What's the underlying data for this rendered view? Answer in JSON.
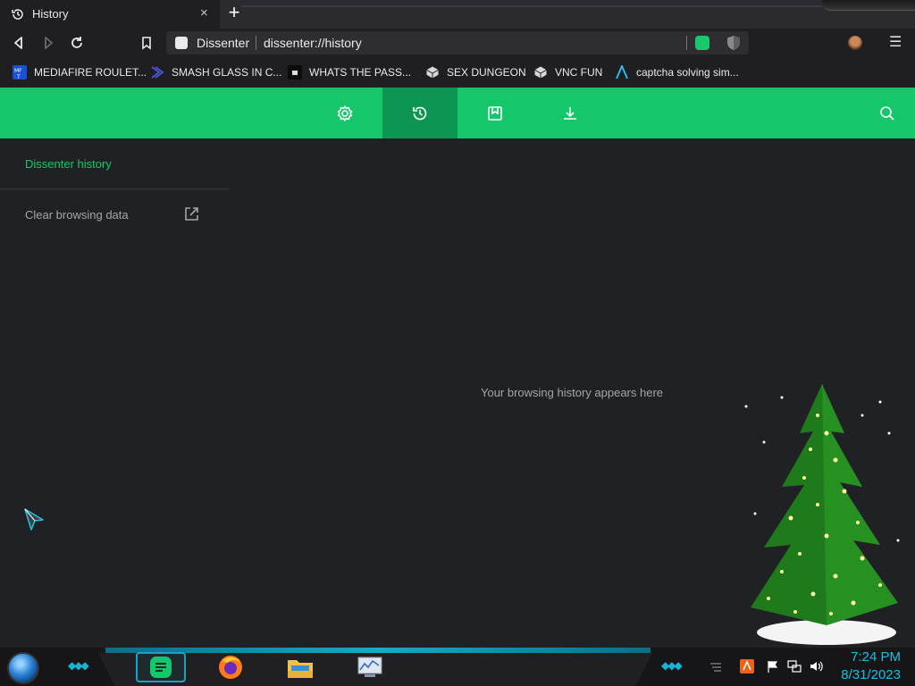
{
  "tab": {
    "title": "History",
    "close": "×",
    "new_tab": "+"
  },
  "omnibox": {
    "site": "Dissenter",
    "url": "dissenter://history"
  },
  "bookmarks": [
    {
      "label": "MEDIAFIRE ROULET...",
      "icon": "mediafire-icon"
    },
    {
      "label": "SMASH GLASS IN C...",
      "icon": "bookmark-chevron-icon"
    },
    {
      "label": "WHATS THE PASS...",
      "icon": "bookmark-dark-icon"
    },
    {
      "label": "SEX DUNGEON",
      "icon": "bookmark-cube-icon"
    },
    {
      "label": "VNC FUN",
      "icon": "bookmark-cube-icon"
    },
    {
      "label": "captcha solving sim...",
      "icon": "bookmark-arrow-icon"
    }
  ],
  "header": {
    "buttons": [
      "settings-icon",
      "history-icon",
      "bookmarks-icon",
      "downloads-icon"
    ],
    "active": "history-icon",
    "accent": "#15c66a"
  },
  "sidebar": {
    "history_label": "Dissenter history",
    "clear_label": "Clear browsing data"
  },
  "main": {
    "empty_message": "Your browsing history appears here"
  },
  "taskbar": {
    "time": "7:24 PM",
    "date": "8/31/2023",
    "apps": [
      "dissenter-icon",
      "firefox-icon",
      "file-explorer-icon",
      "performance-monitor-icon"
    ]
  }
}
